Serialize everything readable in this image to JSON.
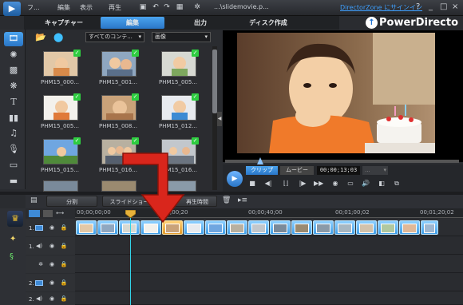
{
  "menu": {
    "file": "フ...",
    "edit": "編集",
    "view": "表示",
    "play": "再生"
  },
  "titlebar": {
    "filename": "...\\slidemovie.p...",
    "directorzone": "DirectorZone にサインイン",
    "help": "?",
    "minimize": "_",
    "restore": "□",
    "close": "×"
  },
  "tabs": {
    "capture": "キャプチャー",
    "edit": "編集",
    "output": "出力",
    "disc": "ディスク作成"
  },
  "logo": "PowerDirecto",
  "library": {
    "filter": "すべてのコンテ...",
    "sort": "画像",
    "items": [
      {
        "label": "PHM15_000..."
      },
      {
        "label": "PHM15_001..."
      },
      {
        "label": "PHM15_005..."
      },
      {
        "label": "PHM15_005..."
      },
      {
        "label": "PHM15_008..."
      },
      {
        "label": "PHM15_012..."
      },
      {
        "label": "PHM15_015..."
      },
      {
        "label": "PHM15_016..."
      },
      {
        "label": "PHM15_016..."
      }
    ]
  },
  "preview": {
    "clip_tab": "クリップ",
    "movie_tab": "ムービー",
    "timecode": "00;00;13;03",
    "quality": "..."
  },
  "edit_toolbar": {
    "split": "分割",
    "slideshow": "スライドショー",
    "duration": "再生時間"
  },
  "timeline": {
    "ticks": [
      "00;00;00;00",
      "00;00;20",
      "00;00;40;00",
      "00;01;00;02",
      "00;01;20;02"
    ],
    "tracks": [
      {
        "num": "1."
      },
      {
        "num": "1."
      },
      {
        "num": ""
      },
      {
        "num": "2."
      },
      {
        "num": "2."
      }
    ]
  },
  "colors": {
    "accent": "#2a76c7",
    "check": "#2ecc40",
    "playhead": "#32d3e8",
    "arrow": "#d9261c"
  }
}
